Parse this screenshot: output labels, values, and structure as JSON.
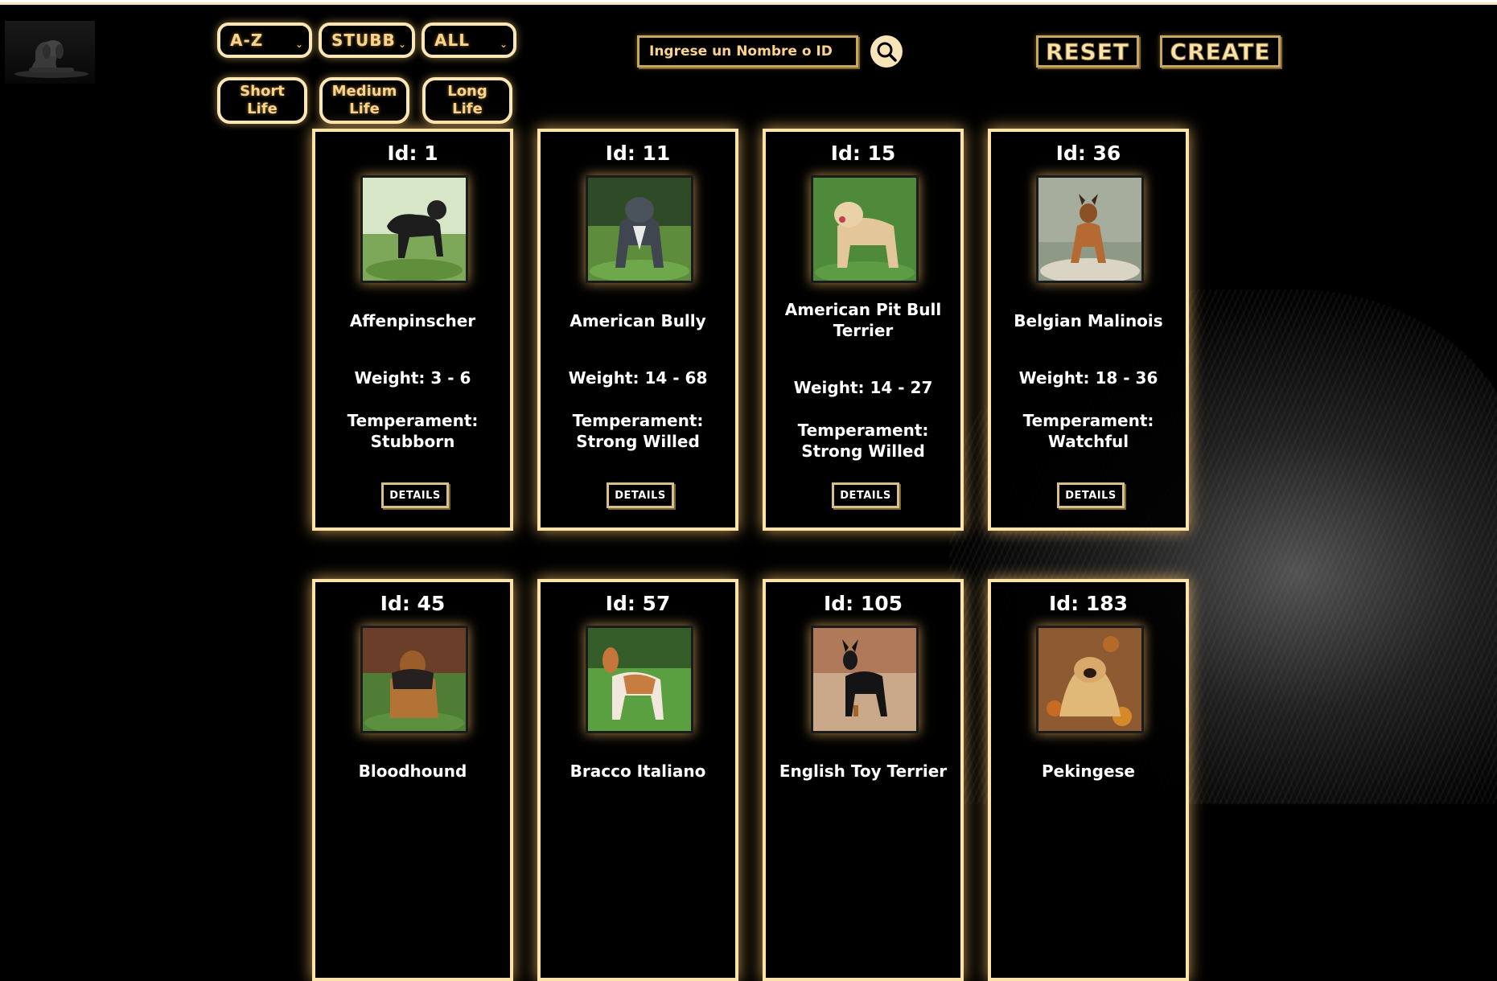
{
  "filters": {
    "sort": {
      "value": "A-Z"
    },
    "temperament": {
      "value": "STUBB"
    },
    "origin": {
      "value": "ALL"
    },
    "life": [
      {
        "label": "Short Life"
      },
      {
        "label": "Medium Life"
      },
      {
        "label": "Long Life"
      }
    ]
  },
  "search": {
    "placeholder": "Ingrese un Nombre o ID"
  },
  "actions": {
    "reset": "RESET",
    "create": "CREATE"
  },
  "cards": [
    {
      "id": "Id: 1",
      "name": "Affenpinscher",
      "weight": "Weight: 3 - 6",
      "temperament_label": "Temperament:",
      "temperament": "Stubborn",
      "details": "DETAILS"
    },
    {
      "id": "Id: 11",
      "name": "American Bully",
      "weight": "Weight: 14 - 68",
      "temperament_label": "Temperament:",
      "temperament": "Strong Willed",
      "details": "DETAILS"
    },
    {
      "id": "Id: 15",
      "name": "American Pit Bull Terrier",
      "weight": "Weight: 14 - 27",
      "temperament_label": "Temperament:",
      "temperament": "Strong Willed",
      "details": "DETAILS"
    },
    {
      "id": "Id: 36",
      "name": "Belgian Malinois",
      "weight": "Weight: 18 - 36",
      "temperament_label": "Temperament:",
      "temperament": "Watchful",
      "details": "DETAILS"
    },
    {
      "id": "Id: 45",
      "name": "Bloodhound"
    },
    {
      "id": "Id: 57",
      "name": "Bracco Italiano"
    },
    {
      "id": "Id: 105",
      "name": "English Toy Terrier"
    },
    {
      "id": "Id: 183",
      "name": "Pekingese"
    }
  ],
  "colors": {
    "accent": "#fbd389",
    "border": "#fbe3a9",
    "glow": "#ffc86e"
  }
}
